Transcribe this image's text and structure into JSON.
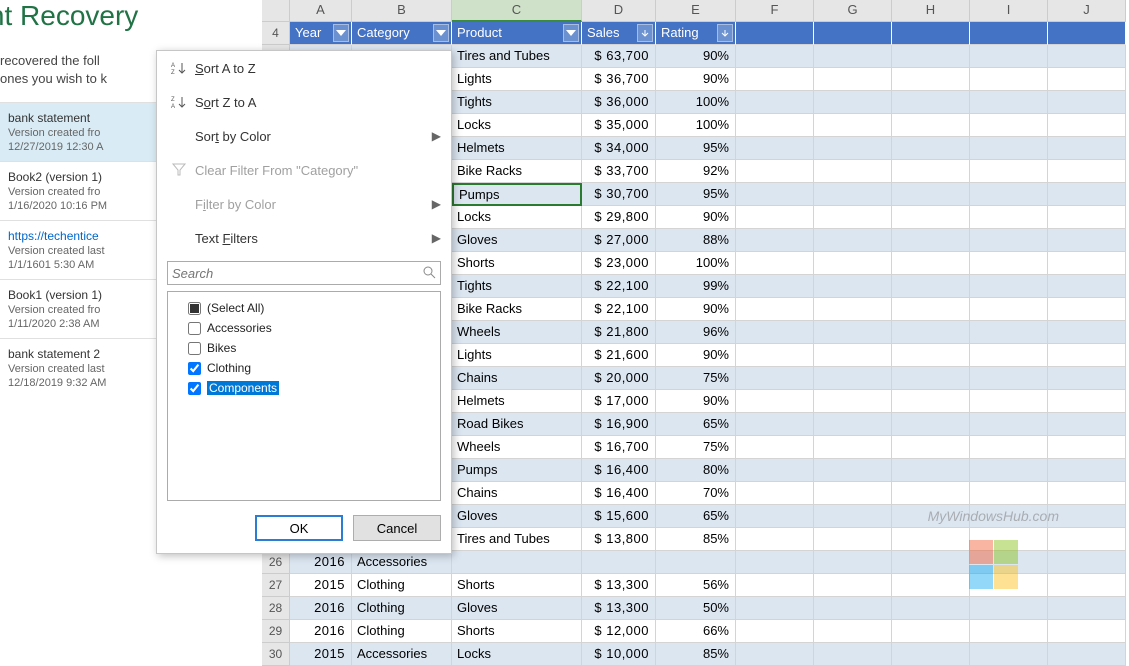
{
  "recovery": {
    "title": "ment Recovery",
    "description": "recovered the foll… ones you wish to k…",
    "desc_line1": "recovered the foll",
    "desc_line2": "ones you wish to k",
    "items": [
      {
        "name": "bank statement ",
        "ver": "Version created fro",
        "dt": "12/27/2019 12:30 A",
        "hl": true
      },
      {
        "name": "Book2 (version 1)",
        "ver": "Version created fro",
        "dt": "1/16/2020 10:16 PM"
      },
      {
        "name": "https://techentice",
        "ver": "Version created last",
        "dt": "1/1/1601 5:30 AM",
        "link": true
      },
      {
        "name": "Book1 (version 1)",
        "ver": "Version created fro",
        "dt": "1/11/2020 2:38 AM"
      },
      {
        "name": "bank statement 2",
        "ver": "Version created last",
        "dt": "12/18/2019 9:32 AM"
      }
    ]
  },
  "columns": [
    "A",
    "B",
    "C",
    "D",
    "E",
    "F",
    "G",
    "H",
    "I",
    "J"
  ],
  "table_header_row": "4",
  "table_headers": {
    "A": "Year",
    "B": "Category",
    "C": "Product",
    "D": "Sales",
    "E": "Rating"
  },
  "rows": [
    {
      "n": "",
      "C": "Tires and Tubes",
      "D": "$ 63,700",
      "E": "90%",
      "band": true
    },
    {
      "n": "",
      "C": "Lights",
      "D": "$ 36,700",
      "E": "90%"
    },
    {
      "n": "",
      "C": "Tights",
      "D": "$ 36,000",
      "E": "100%",
      "band": true
    },
    {
      "n": "",
      "C": "Locks",
      "D": "$ 35,000",
      "E": "100%"
    },
    {
      "n": "",
      "C": "Helmets",
      "D": "$ 34,000",
      "E": "95%",
      "band": true
    },
    {
      "n": "",
      "C": "Bike Racks",
      "D": "$ 33,700",
      "E": "92%"
    },
    {
      "n": "",
      "C": "Pumps",
      "D": "$ 30,700",
      "E": "95%",
      "band": true,
      "active": true
    },
    {
      "n": "",
      "C": "Locks",
      "D": "$ 29,800",
      "E": "90%"
    },
    {
      "n": "",
      "C": "Gloves",
      "D": "$ 27,000",
      "E": "88%",
      "band": true
    },
    {
      "n": "",
      "C": "Shorts",
      "D": "$ 23,000",
      "E": "100%"
    },
    {
      "n": "",
      "C": "Tights",
      "D": "$ 22,100",
      "E": "99%",
      "band": true
    },
    {
      "n": "",
      "C": "Bike Racks",
      "D": "$ 22,100",
      "E": "90%"
    },
    {
      "n": "",
      "C": "Wheels",
      "D": "$ 21,800",
      "E": "96%",
      "band": true
    },
    {
      "n": "",
      "C": "Lights",
      "D": "$ 21,600",
      "E": "90%"
    },
    {
      "n": "",
      "C": "Chains",
      "D": "$ 20,000",
      "E": "75%",
      "band": true
    },
    {
      "n": "",
      "C": "Helmets",
      "D": "$ 17,000",
      "E": "90%"
    },
    {
      "n": "",
      "C": "Road Bikes",
      "D": "$ 16,900",
      "E": "65%",
      "band": true
    },
    {
      "n": "",
      "C": "Wheels",
      "D": "$ 16,700",
      "E": "75%"
    },
    {
      "n": "",
      "C": "Pumps",
      "D": "$ 16,400",
      "E": "80%",
      "band": true
    },
    {
      "n": "",
      "C": "Chains",
      "D": "$ 16,400",
      "E": "70%"
    },
    {
      "n": "",
      "C": "Gloves",
      "D": "$ 15,600",
      "E": "65%",
      "band": true
    },
    {
      "n": "",
      "C": "Tires and Tubes",
      "D": "$ 13,800",
      "E": "85%"
    },
    {
      "n": "26",
      "A": "2016",
      "B": "Accessories",
      "C": "",
      "D": "",
      "E": "",
      "band": true,
      "hidden_lead": true
    },
    {
      "n": "27",
      "A": "2015",
      "B": "Clothing",
      "C": "Shorts",
      "D": "$ 13,300",
      "E": "56%"
    },
    {
      "n": "28",
      "A": "2016",
      "B": "Clothing",
      "C": "Gloves",
      "D": "$ 13,300",
      "E": "50%",
      "band": true
    },
    {
      "n": "29",
      "A": "2016",
      "B": "Clothing",
      "C": "Shorts",
      "D": "$ 12,000",
      "E": "66%"
    },
    {
      "n": "30",
      "A": "2015",
      "B": "Accessories",
      "C": "Locks",
      "D": "$ 10,000",
      "E": "85%",
      "band": true
    }
  ],
  "filter": {
    "sort_az": "Sort A to Z",
    "sort_za": "Sort Z to A",
    "sort_color": "Sort by Color",
    "clear": "Clear Filter From \"Category\"",
    "filter_color": "Filter by Color",
    "text_filters": "Text Filters",
    "search_placeholder": "Search",
    "items": [
      {
        "label": "(Select All)",
        "state": "mixed"
      },
      {
        "label": "Accessories",
        "state": "unchecked"
      },
      {
        "label": "Bikes",
        "state": "unchecked"
      },
      {
        "label": "Clothing",
        "state": "checked"
      },
      {
        "label": "Components",
        "state": "checked",
        "selected": true
      }
    ],
    "ok": "OK",
    "cancel": "Cancel"
  },
  "watermark": "MyWindowsHub.com"
}
